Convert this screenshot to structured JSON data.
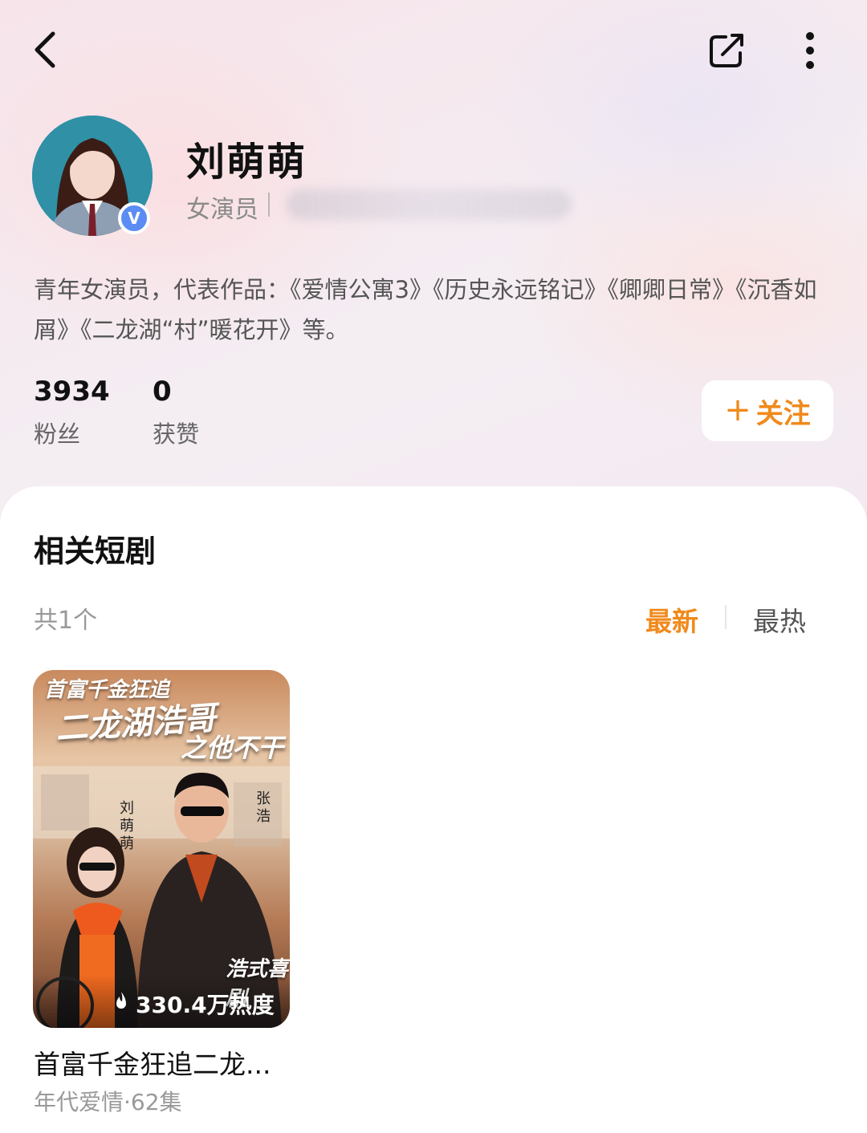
{
  "profile": {
    "name": "刘萌萌",
    "role": "女演员",
    "bio": "青年女演员，代表作品：《爱情公寓3》《历史永远铭记》《卿卿日常》《沉香如屑》《二龙湖“村”暖花开》等。",
    "verify_mark": "V"
  },
  "stats": {
    "fans_value": "3934",
    "fans_label": "粉丝",
    "likes_value": "0",
    "likes_label": "获赞"
  },
  "follow_button": {
    "plus": "+",
    "label": "关注"
  },
  "section": {
    "title": "相关短剧",
    "count": "共1个",
    "sort_new": "最新",
    "sort_hot": "最热"
  },
  "drama": {
    "poster_line1": "首富千金狂追",
    "poster_line2": "二龙湖浩哥",
    "poster_line3": "之他不干",
    "poster_actor_a": "刘萌萌",
    "poster_actor_b": "张浩",
    "poster_tag": "浩式喜剧",
    "heat": "330.4万热度",
    "title": "首富千金狂追二龙...",
    "meta": "年代爱情·62集"
  },
  "icons": {
    "back": "chevron-left-icon",
    "share": "share-icon",
    "more": "more-vertical-icon",
    "verified": "verified-icon",
    "flame": "flame-icon"
  },
  "colors": {
    "accent": "#f08a1c",
    "verify": "#5b8cf3"
  }
}
